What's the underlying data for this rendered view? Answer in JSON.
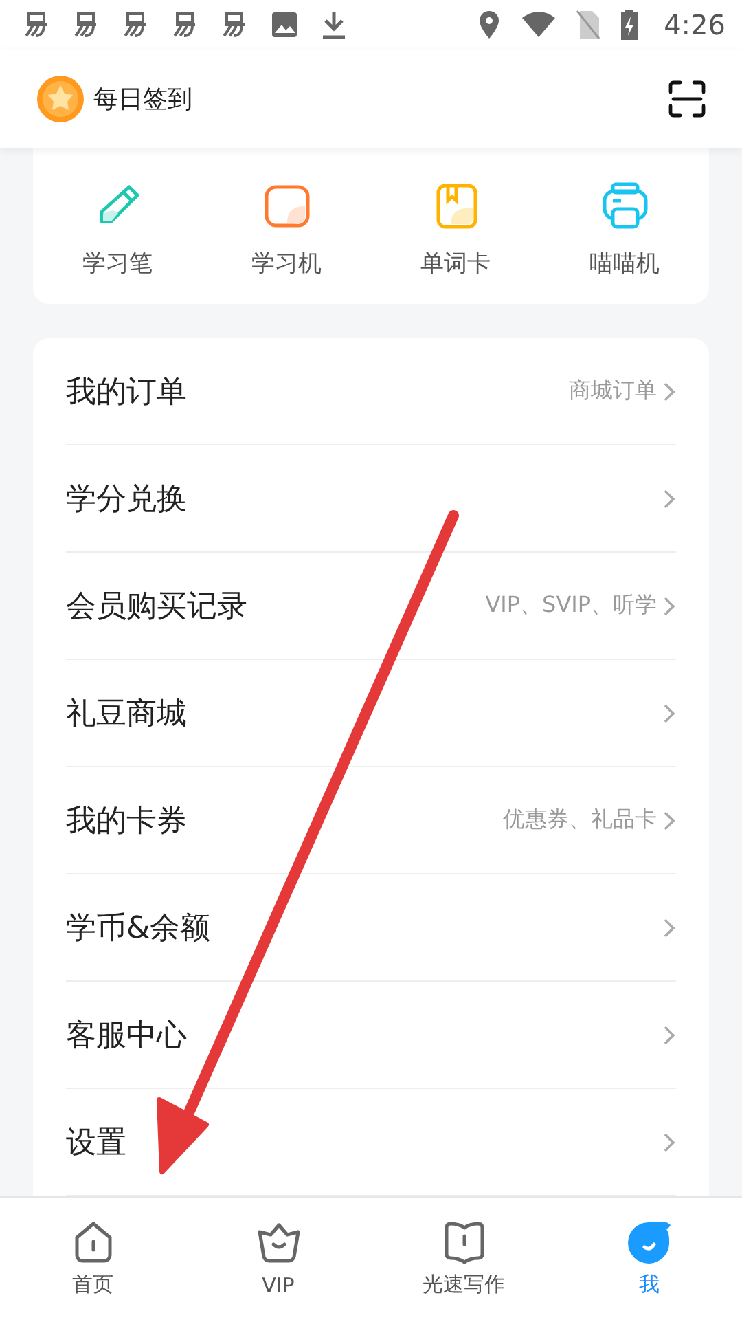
{
  "status_bar": {
    "time": "4:26"
  },
  "header": {
    "checkin": "每日签到"
  },
  "shortcuts": [
    {
      "kind": "pen",
      "label": "学习笔"
    },
    {
      "kind": "tablet",
      "label": "学习机"
    },
    {
      "kind": "card",
      "label": "单词卡"
    },
    {
      "kind": "printer",
      "label": "喵喵机"
    }
  ],
  "menu": [
    {
      "label": "我的订单",
      "hint": "商城订单"
    },
    {
      "label": "学分兑换"
    },
    {
      "label": "会员购买记录",
      "hint": "VIP、SVIP、听学"
    },
    {
      "label": "礼豆商城"
    },
    {
      "label": "我的卡券",
      "hint": "优惠券、礼品卡"
    },
    {
      "label": "学币&余额"
    },
    {
      "label": "客服中心"
    },
    {
      "label": "设置"
    }
  ],
  "nav": [
    {
      "kind": "home",
      "label": "首页",
      "selected": false
    },
    {
      "kind": "vip",
      "label": "VIP",
      "selected": false
    },
    {
      "kind": "book",
      "label": "光速写作",
      "selected": false
    },
    {
      "kind": "me",
      "label": "我",
      "selected": true
    }
  ]
}
